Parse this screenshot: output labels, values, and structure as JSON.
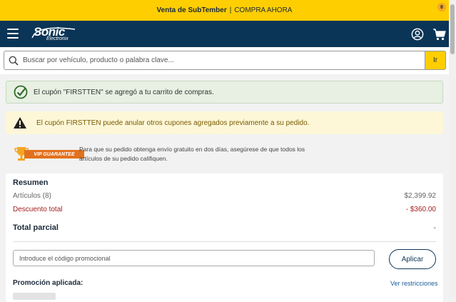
{
  "promo_bar": {
    "title": "Venta de SubTember",
    "separator": "|",
    "cta": "COMPRA AHORA"
  },
  "header": {
    "logo_word": "Sonic",
    "logo_sub": "Electronix",
    "cart_count": "8"
  },
  "search": {
    "placeholder": "Buscar por vehículo, producto o palabra clave...",
    "button": "Ir"
  },
  "alerts": {
    "success": "El cupón \"FIRSTTEN\" se agregó a tu carrito de compras.",
    "warning": "El cupón FIRSTTEN puede anular otros cupones agregados previamente a su pedido."
  },
  "vip": {
    "badge": "VIP GUARANTEE",
    "text": "Para que su pedido obtenga envío gratuito en dos días, asegúrese de que todos los artículos de su pedido califiquen."
  },
  "summary": {
    "title": "Resumen",
    "items_label": "Artículos (8)",
    "items_value": "$2,399.92",
    "discount_label": "Descuento total",
    "discount_value": "- $360.00",
    "subtotal_label": "Total parcial",
    "subtotal_value": "-",
    "code_placeholder": "Introduce el código promocional",
    "apply_label": "Aplicar",
    "promo_applied_label": "Promoción aplicada:",
    "restrictions_link": "Ver restricciones"
  },
  "colors": {
    "promo_bar": "#ffce00",
    "header": "#0b3557",
    "cart_badge": "#f5a623",
    "success_bg": "#e7f0e2",
    "warning_bg": "#fdf7d8",
    "discount": "#a31d1d",
    "vip_ribbon": "#e2711d"
  },
  "icons": {
    "menu": "hamburger-icon",
    "account": "user-circle-icon",
    "cart": "cart-icon",
    "search": "search-icon",
    "success": "check-circle-icon",
    "warning": "warning-triangle-icon",
    "vip": "trophy-icon"
  }
}
